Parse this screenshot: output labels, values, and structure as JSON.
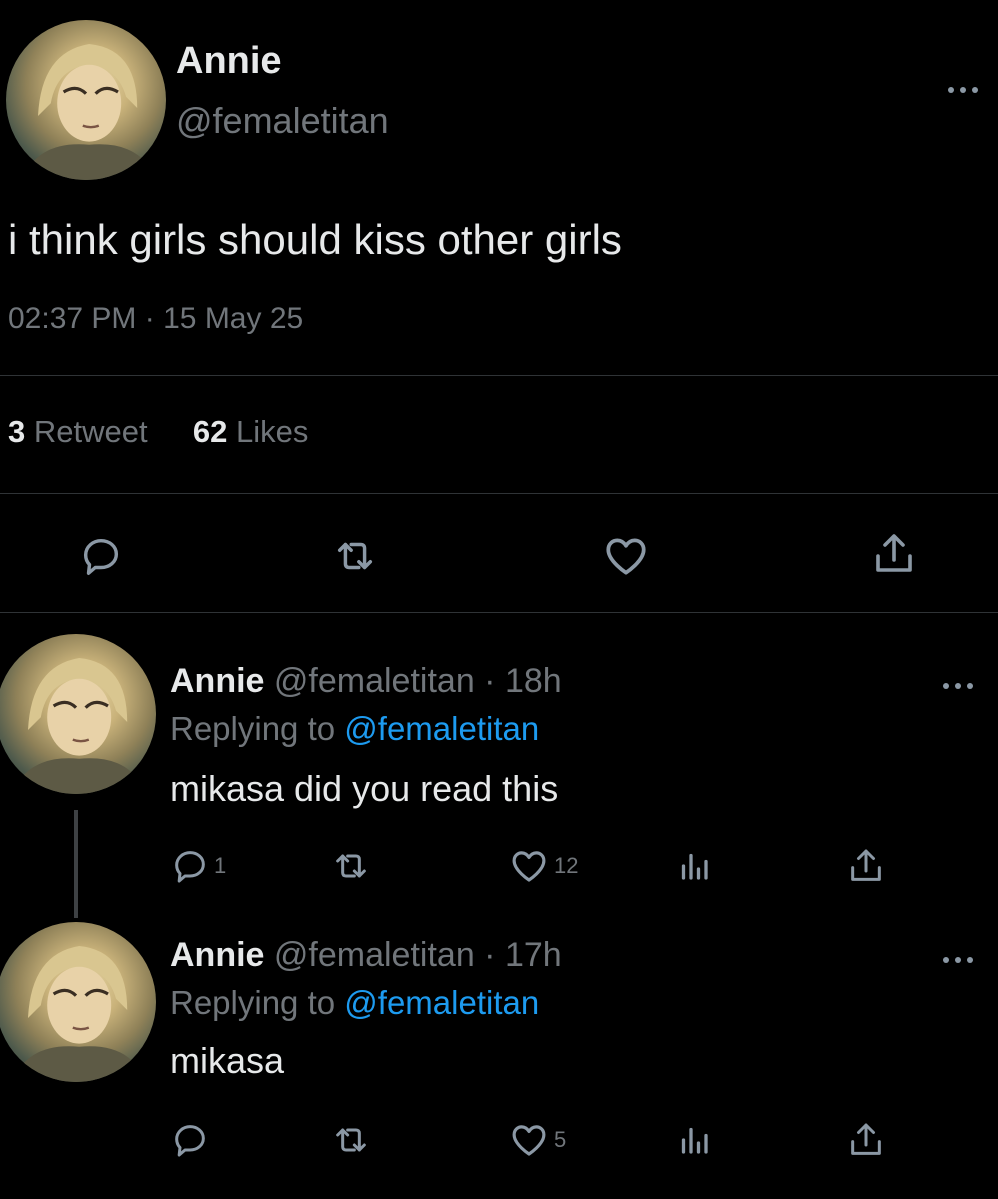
{
  "main_tweet": {
    "display_name": "Annie",
    "handle": "@femaletitan",
    "text": "i think girls should kiss other girls",
    "time": "02:37 PM",
    "separator": "·",
    "date": "15 May 25",
    "retweet_count": "3",
    "retweet_label": "Retweet",
    "like_count": "62",
    "like_label": "Likes",
    "more_icon": "more-icon"
  },
  "replies": [
    {
      "display_name": "Annie",
      "handle_time": "@femaletitan · 18h",
      "replying_prefix": "Replying to",
      "replying_to": "@femaletitan",
      "text": "mikasa did you read this",
      "reply_count": "1",
      "like_count": "12"
    },
    {
      "display_name": "Annie",
      "handle_time": "@femaletitan · 17h",
      "replying_prefix": "Replying to",
      "replying_to": "@femaletitan",
      "text": "mikasa",
      "reply_count": "",
      "like_count": "5"
    }
  ],
  "colors": {
    "background": "#000000",
    "text": "#e7e9ea",
    "muted": "#71767b",
    "link": "#1d9bf0",
    "divider": "#2f3336"
  }
}
